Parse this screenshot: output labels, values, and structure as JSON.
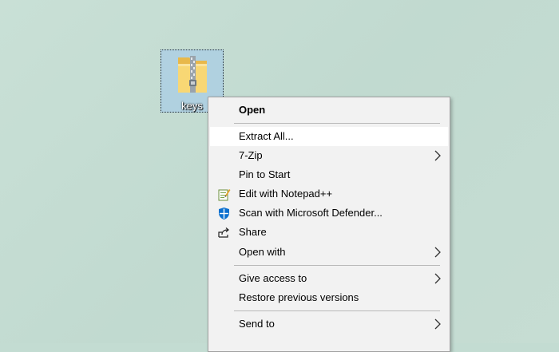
{
  "desktop": {
    "file_icon": {
      "name": "keys",
      "icon": "zip-folder-icon"
    }
  },
  "context_menu": {
    "items": [
      {
        "label": "Open",
        "icon": null,
        "submenu": false
      },
      {
        "label": "Extract All...",
        "icon": null,
        "submenu": false
      },
      {
        "label": "7-Zip",
        "icon": null,
        "submenu": true
      },
      {
        "label": "Pin to Start",
        "icon": null,
        "submenu": false
      },
      {
        "label": "Edit with Notepad++",
        "icon": "notepad-plus-plus-icon",
        "submenu": false
      },
      {
        "label": "Scan with Microsoft Defender...",
        "icon": "defender-shield-icon",
        "submenu": false
      },
      {
        "label": "Share",
        "icon": "share-icon",
        "submenu": false
      },
      {
        "label": "Open with",
        "icon": null,
        "submenu": true
      },
      {
        "label": "Give access to",
        "icon": null,
        "submenu": true
      },
      {
        "label": "Restore previous versions",
        "icon": null,
        "submenu": false
      },
      {
        "label": "Send to",
        "icon": null,
        "submenu": true
      }
    ],
    "highlighted_item": "Extract All..."
  },
  "colors": {
    "desktop_background": "#c3dcd2",
    "selection": "#adcfe3",
    "menu_background": "#f2f2f2",
    "menu_hover": "#ffffff"
  }
}
